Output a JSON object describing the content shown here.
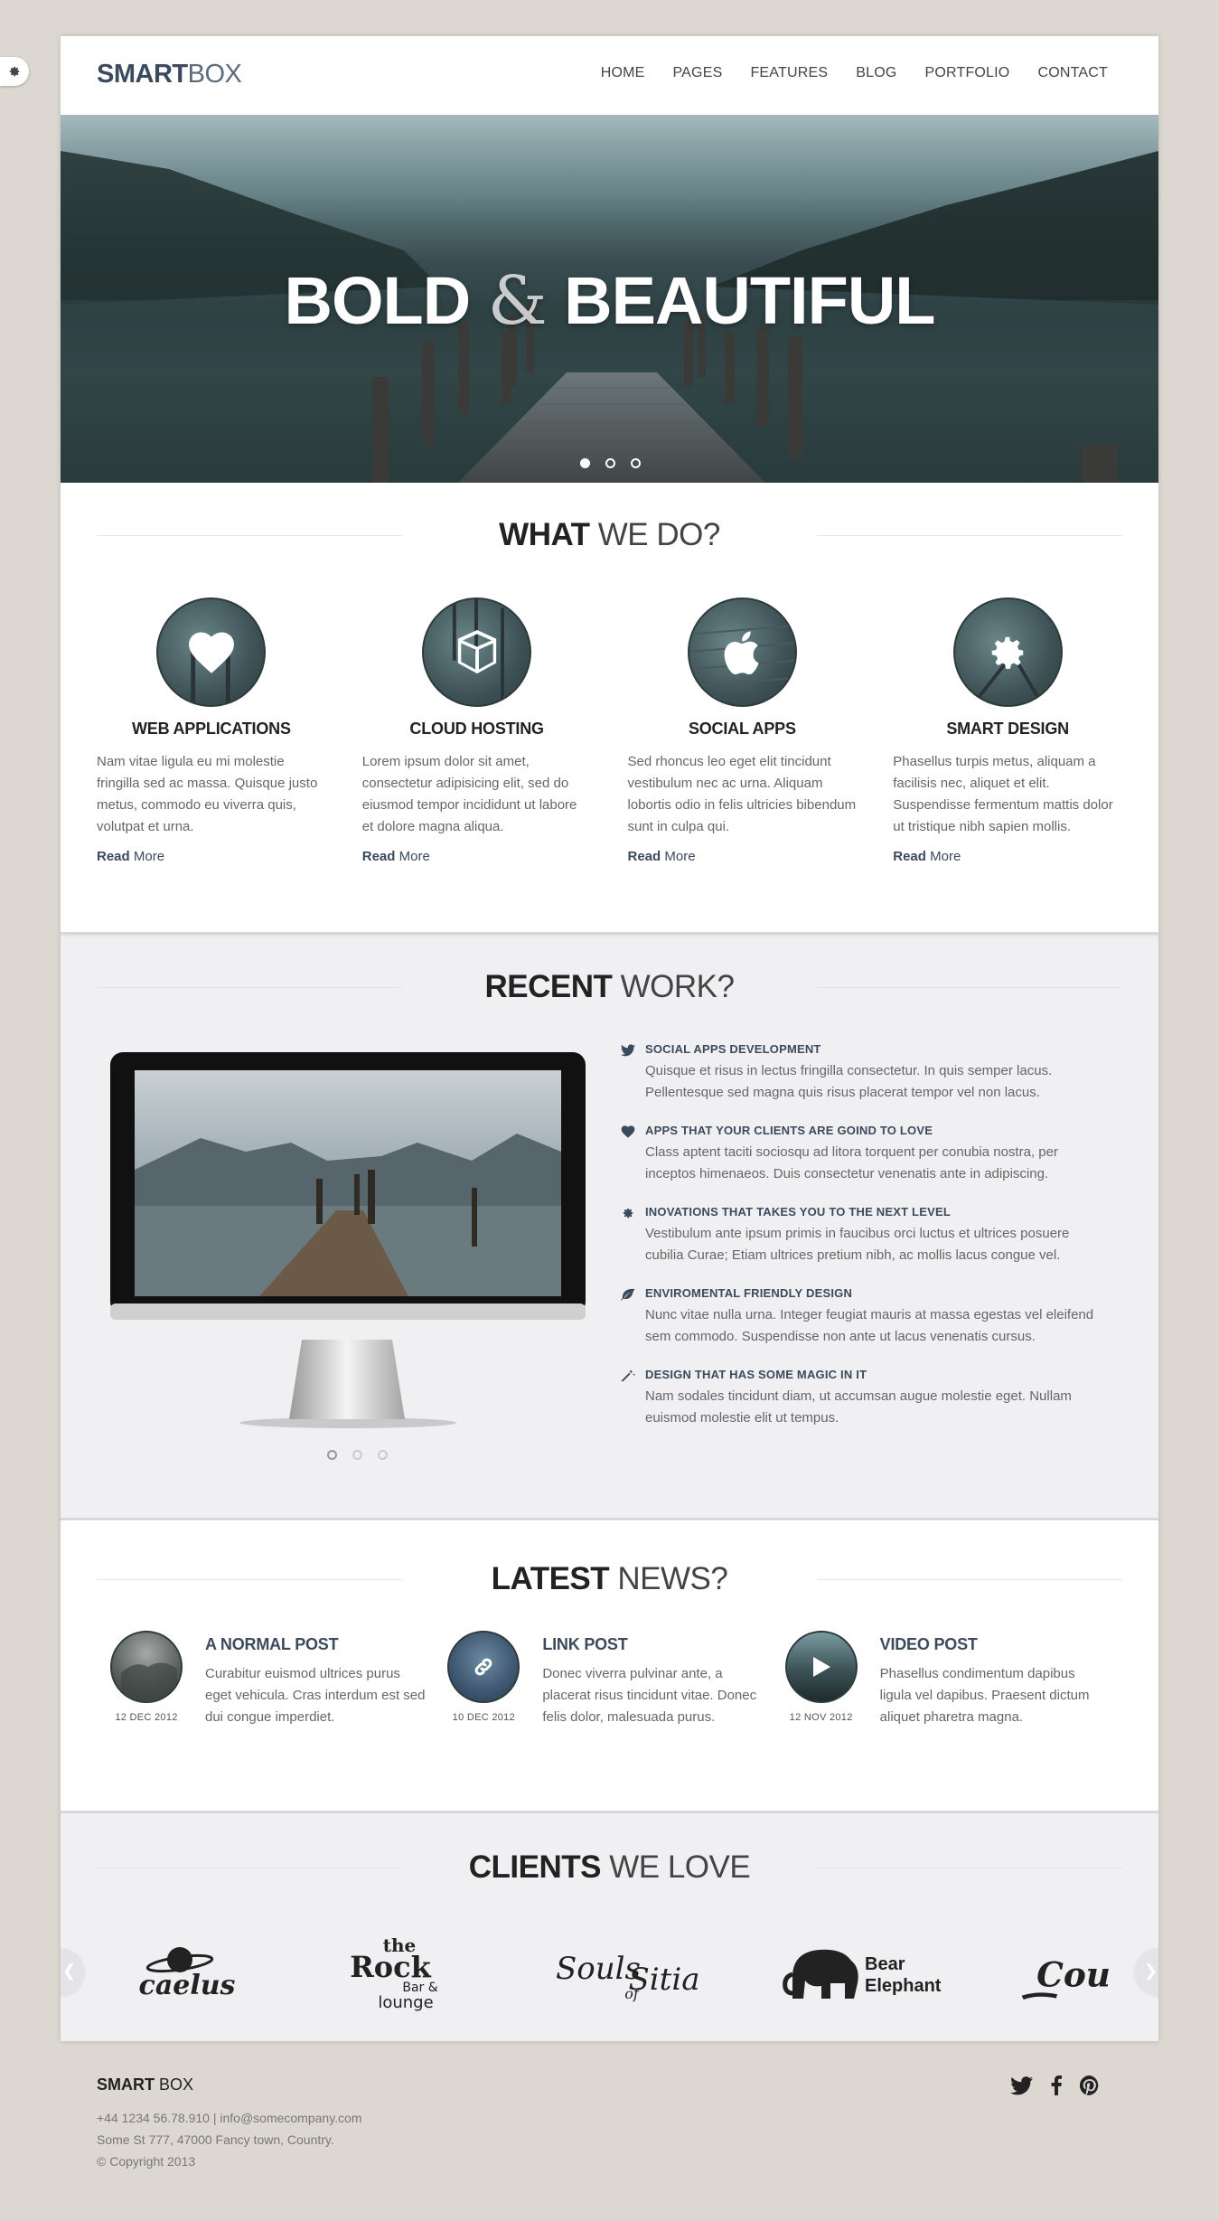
{
  "header": {
    "logo_bold": "SMART",
    "logo_light": "BOX",
    "nav": [
      "HOME",
      "PAGES",
      "FEATURES",
      "BLOG",
      "PORTFOLIO",
      "CONTACT"
    ]
  },
  "hero": {
    "title_bold_1": "BOLD",
    "title_amp": "&",
    "title_bold_2": "BEAUTIFUL",
    "slide_count": 3,
    "active_slide": 1
  },
  "what": {
    "title_bold": "WHAT",
    "title_light": "WE DO?",
    "services": [
      {
        "icon": "heart-icon",
        "title": "WEB APPLICATIONS",
        "text": "Nam vitae ligula eu mi molestie fringilla sed ac massa. Quisque justo metus, commodo eu viverra quis, volutpat et urna.",
        "read_bold": "Read",
        "read_light": "More"
      },
      {
        "icon": "cube-icon",
        "title": "CLOUD HOSTING",
        "text": "Lorem ipsum dolor sit amet, consectetur adipisicing elit, sed do eiusmod tempor incididunt ut labore et dolore magna aliqua.",
        "read_bold": "Read",
        "read_light": "More"
      },
      {
        "icon": "apple-icon",
        "title": "SOCIAL APPS",
        "text": "Sed rhoncus leo eget elit tincidunt vestibulum nec ac urna. Aliquam lobortis odio in felis ultricies bibendum sunt in culpa qui.",
        "read_bold": "Read",
        "read_light": "More"
      },
      {
        "icon": "gear-icon",
        "title": "SMART DESIGN",
        "text": "Phasellus turpis metus, aliquam a facilisis nec, aliquet et elit. Suspendisse fermentum mattis dolor ut tristique nibh sapien mollis.",
        "read_bold": "Read",
        "read_light": "More"
      }
    ]
  },
  "recent": {
    "title_bold": "RECENT",
    "title_light": "WORK?",
    "slide_count": 3,
    "active_slide": 1,
    "features": [
      {
        "icon": "twitter-icon",
        "title": "SOCIAL APPS DEVELOPMENT",
        "text": "Quisque et risus in lectus fringilla consectetur. In quis semper lacus. Pellentesque sed magna quis risus placerat tempor vel non lacus."
      },
      {
        "icon": "heart-icon",
        "title": "APPS THAT YOUR CLIENTS ARE GOIND TO LOVE",
        "text": "Class aptent taciti sociosqu ad litora torquent per conubia nostra, per inceptos himenaeos. Duis consectetur venenatis ante in adipiscing."
      },
      {
        "icon": "gear-icon",
        "title": "INOVATIONS THAT TAKES YOU TO THE NEXT LEVEL",
        "text": "Vestibulum ante ipsum primis in faucibus orci luctus et ultrices posuere cubilia Curae; Etiam ultrices pretium nibh, ac mollis lacus congue vel."
      },
      {
        "icon": "leaf-icon",
        "title": "ENVIROMENTAL FRIENDLY DESIGN",
        "text": "Nunc vitae nulla urna. Integer feugiat mauris at massa egestas vel eleifend sem commodo. Suspendisse non ante ut lacus venenatis cursus."
      },
      {
        "icon": "magic-wand-icon",
        "title": "DESIGN THAT HAS SOME MAGIC IN IT",
        "text": "Nam sodales tincidunt diam, ut accumsan augue molestie eget. Nullam euismod molestie elit ut tempus."
      }
    ]
  },
  "news": {
    "title_bold": "LATEST",
    "title_light": "NEWS?",
    "posts": [
      {
        "thumb": "cloud-photo",
        "date": "12 DEC 2012",
        "title": "A NORMAL POST",
        "text": "Curabitur euismod ultrices purus eget vehicula. Cras interdum est sed dui congue imperdiet."
      },
      {
        "thumb": "link-icon",
        "date": "10 DEC 2012",
        "title": "LINK POST",
        "text": "Donec viverra pulvinar ante, a placerat risus tincidunt vitae. Donec felis dolor, malesuada purus."
      },
      {
        "thumb": "play-icon",
        "date": "12 NOV 2012",
        "title": "VIDEO POST",
        "text": "Phasellus condimentum dapibus ligula vel dapibus. Praesent dictum aliquet pharetra magna."
      }
    ]
  },
  "clients": {
    "title_bold": "CLIENTS",
    "title_light": "WE LOVE",
    "logos": [
      {
        "name": "caelus",
        "label": "caelus"
      },
      {
        "name": "the-rock",
        "line1": "the",
        "line2": "Rock",
        "line3": "Bar &",
        "line4": "lounge"
      },
      {
        "name": "souls-of-sitia",
        "line1": "Souls",
        "line2": "of",
        "line3": "Sitia"
      },
      {
        "name": "bear-elephant",
        "line1": "Bear",
        "line2": "Elephant"
      },
      {
        "name": "cou",
        "label": "Cou"
      }
    ]
  },
  "footer": {
    "logo_bold": "SMART",
    "logo_light": "BOX",
    "contact": "+44 1234 56.78.910 | info@somecompany.com",
    "address": "Some St 777, 47000 Fancy town, Country.",
    "copyright": "© Copyright 2013"
  },
  "colors": {
    "accent": "#3b4a5c",
    "background": "#dcd8d1",
    "section_alt": "#f0f0f2"
  }
}
